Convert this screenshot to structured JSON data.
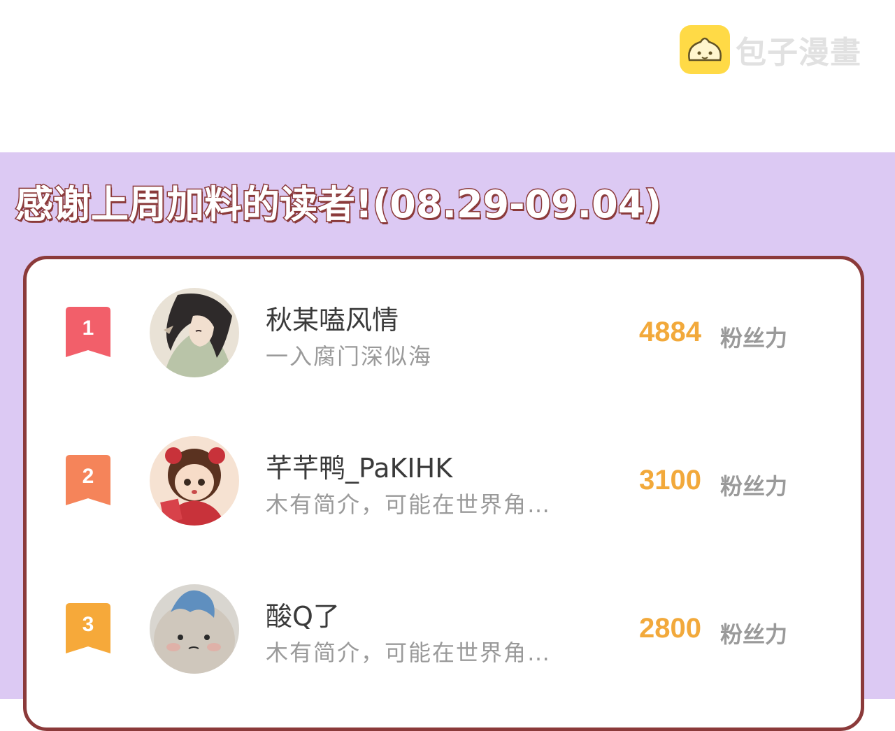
{
  "watermark": {
    "text": "包子漫畫",
    "logo_color": "#ffd93d"
  },
  "heading": {
    "text": "感谢上周加料的读者!(08.29-09.04)"
  },
  "colors": {
    "background_band": "#dcc9f3",
    "card_border": "#8b3a3a",
    "score": "#f2a93b",
    "rank1": "#f25f6a",
    "rank2": "#f5845a",
    "rank3": "#f6a93a"
  },
  "leaderboard": {
    "unit_label": "粉丝力",
    "entries": [
      {
        "rank": "1",
        "username": "秋某嗑风情",
        "bio": "一入腐门深似海",
        "score": "4884",
        "avatar_icon": "anime-illustration-avatar"
      },
      {
        "rank": "2",
        "username": "芊芊鸭_PaKIHK",
        "bio": "木有简介，可能在世界角…",
        "score": "3100",
        "avatar_icon": "anime-girl-avatar"
      },
      {
        "rank": "3",
        "username": "酸Q了",
        "bio": "木有简介，可能在世界角…",
        "score": "2800",
        "avatar_icon": "plush-toy-avatar"
      }
    ]
  }
}
